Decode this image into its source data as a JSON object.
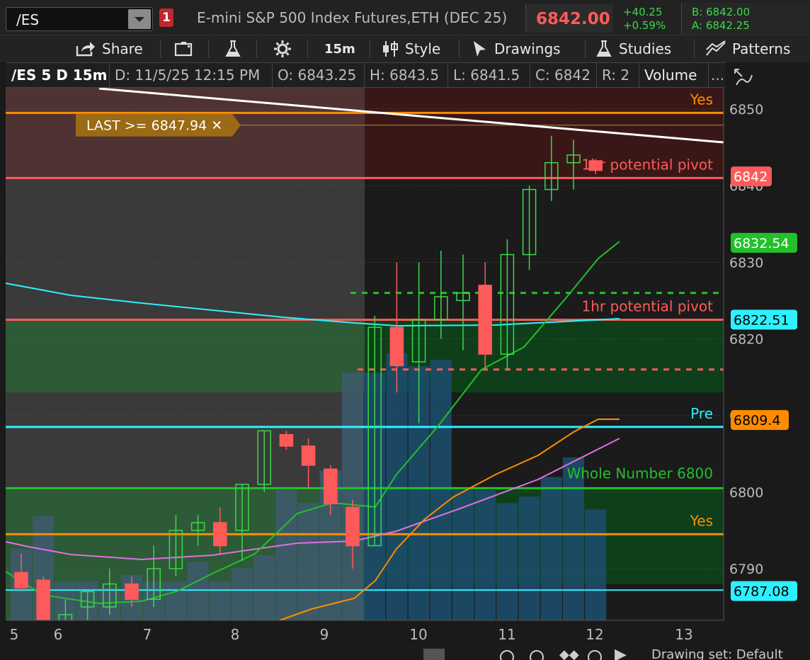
{
  "header": {
    "symbol": "/ES",
    "link_badge": "1",
    "instrument": "E-mini S&P 500 Index Futures,ETH (DEC 25)",
    "last_price": "6842.00",
    "change_abs": "+40.25",
    "change_pct": "+0.59%",
    "bid": "B: 6842.00",
    "ask": "A: 6842.25"
  },
  "toolbar": {
    "share": "Share",
    "timeframe": "15m",
    "style": "Style",
    "drawings": "Drawings",
    "studies": "Studies",
    "patterns": "Patterns"
  },
  "info_row": {
    "chart_symbol": "/ES 5 D 15m",
    "date": "D: 11/5/25 12:15 PM",
    "open": "O: 6843.25",
    "high": "H: 6843.5",
    "low": "L: 6841.5",
    "close": "C: 6842",
    "range": "R: 2",
    "volume": "Volume",
    "more": "..."
  },
  "bottom": {
    "drawing_set": "Drawing set: Default"
  },
  "colors": {
    "up": "#3cd84a",
    "down": "#ff5a5a",
    "orange": "#ff8c00",
    "cyan": "#2ff0ff",
    "green_line": "#22c02a",
    "red_line": "#ff5a5a",
    "magenta": "#e070e0"
  },
  "chart_data": {
    "type": "candlestick",
    "ylim": [
      6778,
      6852
    ],
    "y_ticks": [
      6790,
      6800,
      6810,
      6820,
      6830,
      6840,
      6850
    ],
    "x_ticks": [
      "5",
      "6",
      "7",
      "8",
      "9",
      "10",
      "11",
      "12",
      "13"
    ],
    "candles": [
      {
        "o": 6789.5,
        "h": 6792,
        "l": 6787,
        "c": 6787.5
      },
      {
        "o": 6788.5,
        "h": 6789,
        "l": 6776,
        "c": 6778
      },
      {
        "o": 6783,
        "h": 6786,
        "l": 6778,
        "c": 6784
      },
      {
        "o": 6785,
        "h": 6787,
        "l": 6781,
        "c": 6787
      },
      {
        "o": 6785,
        "h": 6790,
        "l": 6784,
        "c": 6788
      },
      {
        "o": 6788,
        "h": 6789,
        "l": 6785,
        "c": 6786
      },
      {
        "o": 6786,
        "h": 6793,
        "l": 6785,
        "c": 6790
      },
      {
        "o": 6790,
        "h": 6797,
        "l": 6789,
        "c": 6795
      },
      {
        "o": 6795,
        "h": 6797,
        "l": 6793,
        "c": 6796
      },
      {
        "o": 6796,
        "h": 6798,
        "l": 6792,
        "c": 6793
      },
      {
        "o": 6795,
        "h": 6801,
        "l": 6791,
        "c": 6801
      },
      {
        "o": 6801,
        "h": 6808,
        "l": 6800,
        "c": 6808
      },
      {
        "o": 6807.5,
        "h": 6808,
        "l": 6805.5,
        "c": 6806
      },
      {
        "o": 6806,
        "h": 6807,
        "l": 6800.5,
        "c": 6803.5
      },
      {
        "o": 6803,
        "h": 6803.5,
        "l": 6797,
        "c": 6798.5
      },
      {
        "o": 6798,
        "h": 6799,
        "l": 6790,
        "c": 6793
      },
      {
        "o": 6793,
        "h": 6823,
        "l": 6793,
        "c": 6821.5
      },
      {
        "o": 6821.5,
        "h": 6830,
        "l": 6813,
        "c": 6816.5
      },
      {
        "o": 6817,
        "h": 6830,
        "l": 6809,
        "c": 6822.5
      },
      {
        "o": 6822.5,
        "h": 6831.5,
        "l": 6820,
        "c": 6825.5
      },
      {
        "o": 6825,
        "h": 6831,
        "l": 6818.5,
        "c": 6826
      },
      {
        "o": 6827,
        "h": 6830,
        "l": 6816,
        "c": 6818
      },
      {
        "o": 6818,
        "h": 6833,
        "l": 6816,
        "c": 6831
      },
      {
        "o": 6831,
        "h": 6840,
        "l": 6829,
        "c": 6839.5
      },
      {
        "o": 6839.5,
        "h": 6846.5,
        "l": 6838,
        "c": 6843
      },
      {
        "o": 6843,
        "h": 6846,
        "l": 6839.5,
        "c": 6844
      },
      {
        "o": 6843.25,
        "h": 6843.5,
        "l": 6841.5,
        "c": 6842
      }
    ],
    "volume": [
      11,
      16,
      6,
      6,
      5,
      7,
      6,
      6,
      9,
      6,
      8,
      10,
      20,
      18,
      23,
      38,
      38,
      41,
      39,
      40,
      20,
      20,
      18,
      19,
      22,
      25,
      17
    ],
    "levels": [
      {
        "name": "Yes",
        "value": 6849.5,
        "color": "#ff8c00"
      },
      {
        "name": "1hr potential pivot",
        "value": 6841,
        "color": "#ff5a5a"
      },
      {
        "name": "1hr potential pivot",
        "value": 6822.5,
        "color": "#ff5a5a"
      },
      {
        "name": "Pre",
        "value": 6808.5,
        "color": "#2ff0ff"
      },
      {
        "name": "Whole Number 6800",
        "value": 6800.5,
        "color": "#22c02a"
      },
      {
        "name": "Yes",
        "value": 6794.5,
        "color": "#ff8c00"
      }
    ],
    "price_labels": [
      {
        "value": "6842",
        "y": 6841.2,
        "bg": "#ff5a5a",
        "fg": "#fff"
      },
      {
        "value": "6832.54",
        "y": 6832.54,
        "bg": "#22c02a",
        "fg": "#fff"
      },
      {
        "value": "6822.51",
        "y": 6822.51,
        "bg": "#2ff0ff",
        "fg": "#000"
      },
      {
        "value": "6809.4",
        "y": 6809.4,
        "bg": "#ff8c00",
        "fg": "#000"
      },
      {
        "value": "6787.08",
        "y": 6787.08,
        "bg": "#2ff0ff",
        "fg": "#000"
      }
    ],
    "alert": "LAST >= 6847.94"
  }
}
